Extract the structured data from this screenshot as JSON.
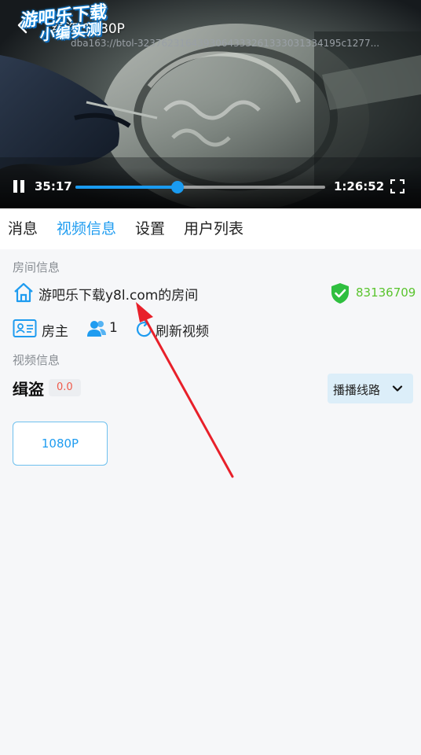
{
  "player": {
    "watermark_line1": "游吧乐下载",
    "watermark_line2": "小编实测",
    "title": "缉盗 1080P",
    "stream_url": "dba163://btol-3237623164393064333261333031334195c1277...",
    "time_current": "35:17",
    "time_total": "1:26:52",
    "progress": 0.41
  },
  "tabs": [
    "消息",
    "视频信息",
    "设置",
    "用户列表"
  ],
  "active_tab": 1,
  "room": {
    "section_label": "房间信息",
    "name": "游吧乐下载y8l.com的房间",
    "id": "83136709",
    "host_label": "房主",
    "user_count": "1",
    "refresh_label": "刷新视频"
  },
  "video": {
    "section_label": "视频信息",
    "name": "缉盗",
    "score": "0.0",
    "route_label": "播播线路",
    "quality": "1080P"
  },
  "colors": {
    "accent": "#1f9cf0",
    "verified": "#5ac42e",
    "score": "#f05a4a",
    "annotation": "#e8202a"
  }
}
